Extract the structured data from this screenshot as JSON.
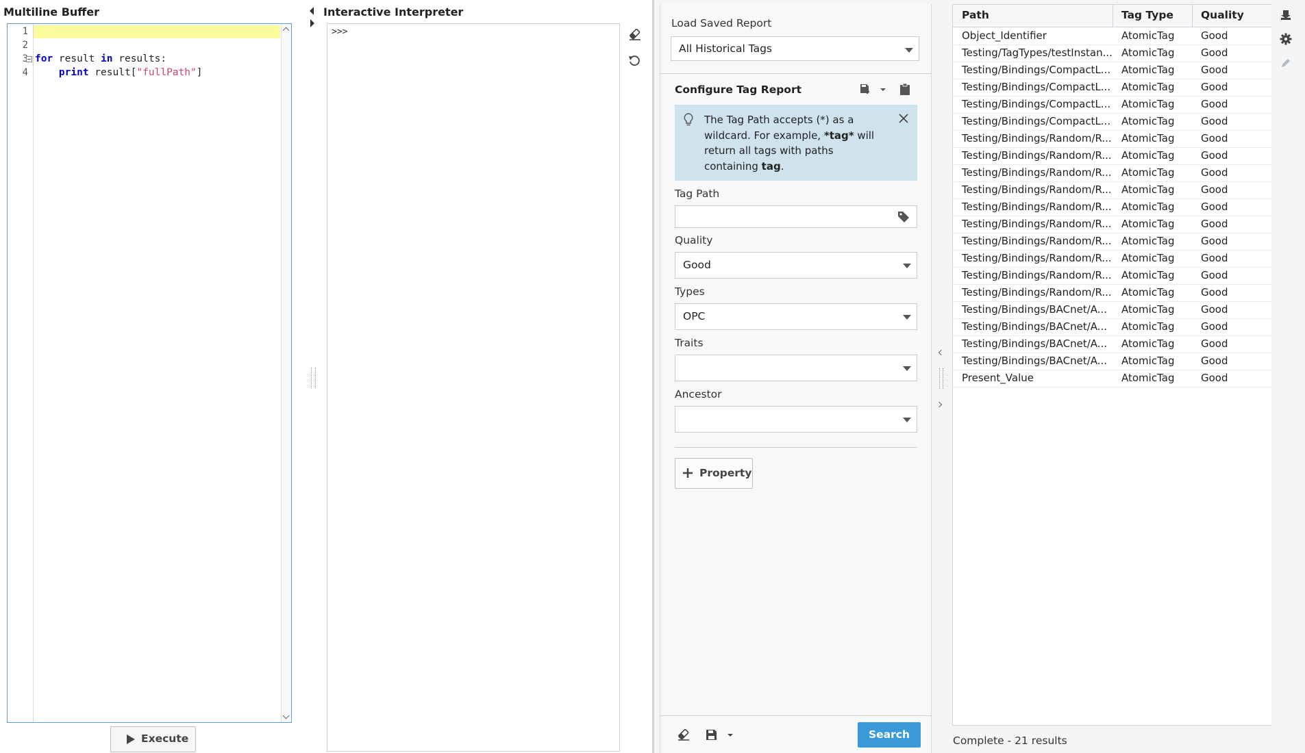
{
  "left_panel": {
    "title": "Multiline Buffer",
    "line_numbers": [
      "1",
      "2",
      "3",
      "4"
    ],
    "code": {
      "line3_kw1": "for",
      "line3_mid": " result ",
      "line3_kw2": "in",
      "line3_end": " results:",
      "line4_indent": "    ",
      "line4_kw": "print",
      "line4_mid": " result[",
      "line4_str": "\"fullPath\"",
      "line4_end": "]"
    },
    "execute_label": "Execute"
  },
  "interpreter": {
    "title": "Interactive Interpreter",
    "prompt": ">>>"
  },
  "config": {
    "load_saved_label": "Load Saved Report",
    "load_saved_value": "All Historical Tags",
    "section_title": "Configure Tag Report",
    "tip_text_1": "The Tag Path accepts (*) as a wildcard. For example, ",
    "tip_bold_1": "*tag*",
    "tip_text_2": " will return all tags with paths containing ",
    "tip_bold_2": "tag",
    "tip_text_3": ".",
    "tag_path_label": "Tag Path",
    "tag_path_value": "",
    "quality_label": "Quality",
    "quality_value": "Good",
    "types_label": "Types",
    "types_value": "OPC",
    "traits_label": "Traits",
    "traits_value": "",
    "ancestor_label": "Ancestor",
    "ancestor_value": "",
    "property_button": "Property",
    "search_button": "Search"
  },
  "results": {
    "columns": [
      "Path",
      "Tag Type",
      "Quality"
    ],
    "rows": [
      [
        "Object_Identifier",
        "AtomicTag",
        "Good"
      ],
      [
        "Testing/TagTypes/testInstan...",
        "AtomicTag",
        "Good"
      ],
      [
        "Testing/Bindings/CompactL...",
        "AtomicTag",
        "Good"
      ],
      [
        "Testing/Bindings/CompactL...",
        "AtomicTag",
        "Good"
      ],
      [
        "Testing/Bindings/CompactL...",
        "AtomicTag",
        "Good"
      ],
      [
        "Testing/Bindings/CompactL...",
        "AtomicTag",
        "Good"
      ],
      [
        "Testing/Bindings/Random/R...",
        "AtomicTag",
        "Good"
      ],
      [
        "Testing/Bindings/Random/R...",
        "AtomicTag",
        "Good"
      ],
      [
        "Testing/Bindings/Random/R...",
        "AtomicTag",
        "Good"
      ],
      [
        "Testing/Bindings/Random/R...",
        "AtomicTag",
        "Good"
      ],
      [
        "Testing/Bindings/Random/R...",
        "AtomicTag",
        "Good"
      ],
      [
        "Testing/Bindings/Random/R...",
        "AtomicTag",
        "Good"
      ],
      [
        "Testing/Bindings/Random/R...",
        "AtomicTag",
        "Good"
      ],
      [
        "Testing/Bindings/Random/R...",
        "AtomicTag",
        "Good"
      ],
      [
        "Testing/Bindings/Random/R...",
        "AtomicTag",
        "Good"
      ],
      [
        "Testing/Bindings/Random/R...",
        "AtomicTag",
        "Good"
      ],
      [
        "Testing/Bindings/BACnet/A...",
        "AtomicTag",
        "Good"
      ],
      [
        "Testing/Bindings/BACnet/A...",
        "AtomicTag",
        "Good"
      ],
      [
        "Testing/Bindings/BACnet/A...",
        "AtomicTag",
        "Good"
      ],
      [
        "Testing/Bindings/BACnet/A...",
        "AtomicTag",
        "Good"
      ],
      [
        "Present_Value",
        "AtomicTag",
        "Good"
      ]
    ],
    "status": "Complete - 21 results"
  },
  "icons": {
    "clear": "eraser-icon",
    "reset": "reset-icon",
    "tag": "tag-icon",
    "lightbulb": "lightbulb-icon",
    "close": "close-icon",
    "save": "save-icon",
    "clipboard": "clipboard-icon",
    "export": "export-icon",
    "settings": "gear-icon",
    "edit": "pencil-icon"
  },
  "colors": {
    "accent": "#3a9ad9",
    "tip_background": "#cfe3ef",
    "line_highlight": "#fbfb9b",
    "keyword": "#0000c8",
    "string": "#d04070"
  }
}
